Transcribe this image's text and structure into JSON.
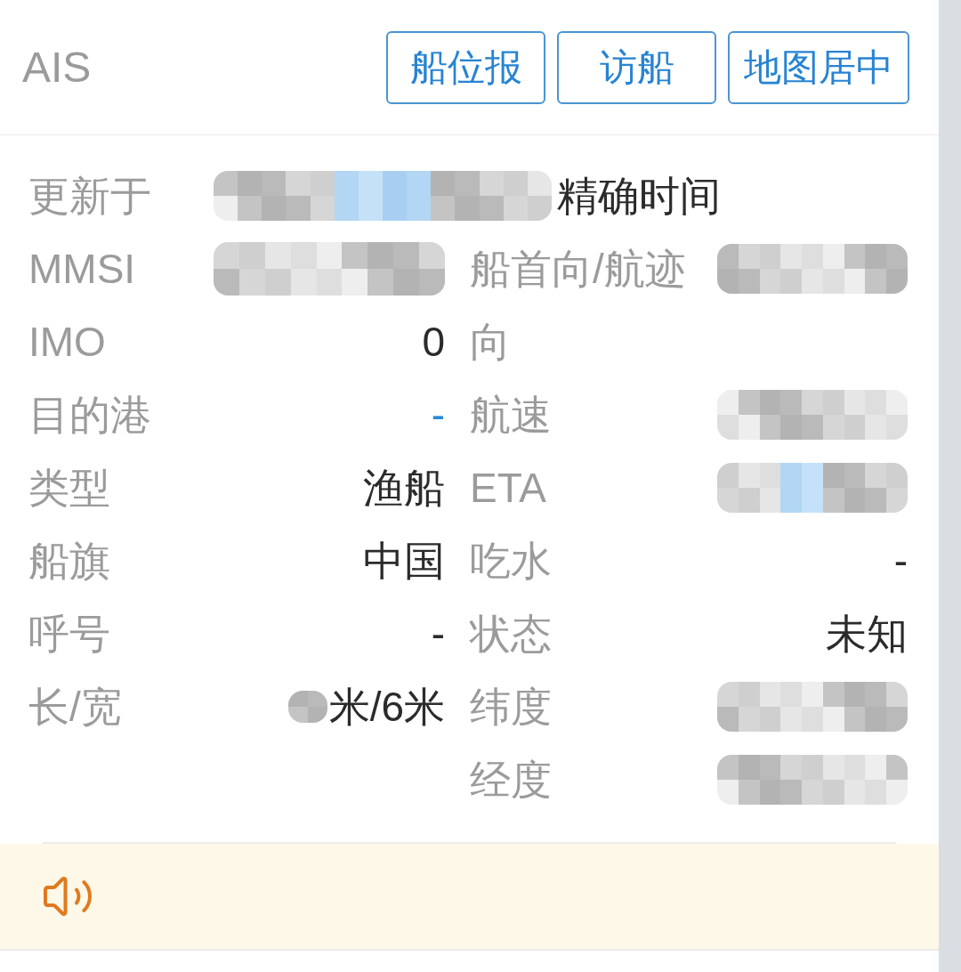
{
  "header": {
    "title": "AIS",
    "buttons": [
      "船位报",
      "访船",
      "地图居中"
    ]
  },
  "updated": {
    "label": "更新于",
    "redacted": true,
    "value": "精确时间"
  },
  "left_fields": [
    {
      "label": "MMSI",
      "redacted": true,
      "link": false
    },
    {
      "label": "IMO",
      "value": "0",
      "redacted": false,
      "link": false
    },
    {
      "label": "目的港",
      "value": "-",
      "redacted": false,
      "link": true
    },
    {
      "label": "类型",
      "value": "渔船",
      "redacted": false,
      "link": false
    },
    {
      "label": "船旗",
      "value": "中国",
      "redacted": false,
      "link": false
    },
    {
      "label": "呼号",
      "value": "-",
      "redacted": false,
      "link": false
    },
    {
      "label": "长/宽",
      "value": "米/6米",
      "redacted": true,
      "link": false
    }
  ],
  "right_fields": [
    {
      "label": "船首向/航迹向",
      "redacted": true,
      "link": false
    },
    {
      "label": "航速",
      "redacted": true,
      "link": false
    },
    {
      "label": "ETA",
      "redacted": true,
      "link": true
    },
    {
      "label": "吃水",
      "value": "-",
      "redacted": false,
      "link": false
    },
    {
      "label": "状态",
      "value": "未知",
      "redacted": false,
      "link": false
    },
    {
      "label": "纬度",
      "redacted": true,
      "link": false
    },
    {
      "label": "经度",
      "redacted": true,
      "link": false
    }
  ]
}
